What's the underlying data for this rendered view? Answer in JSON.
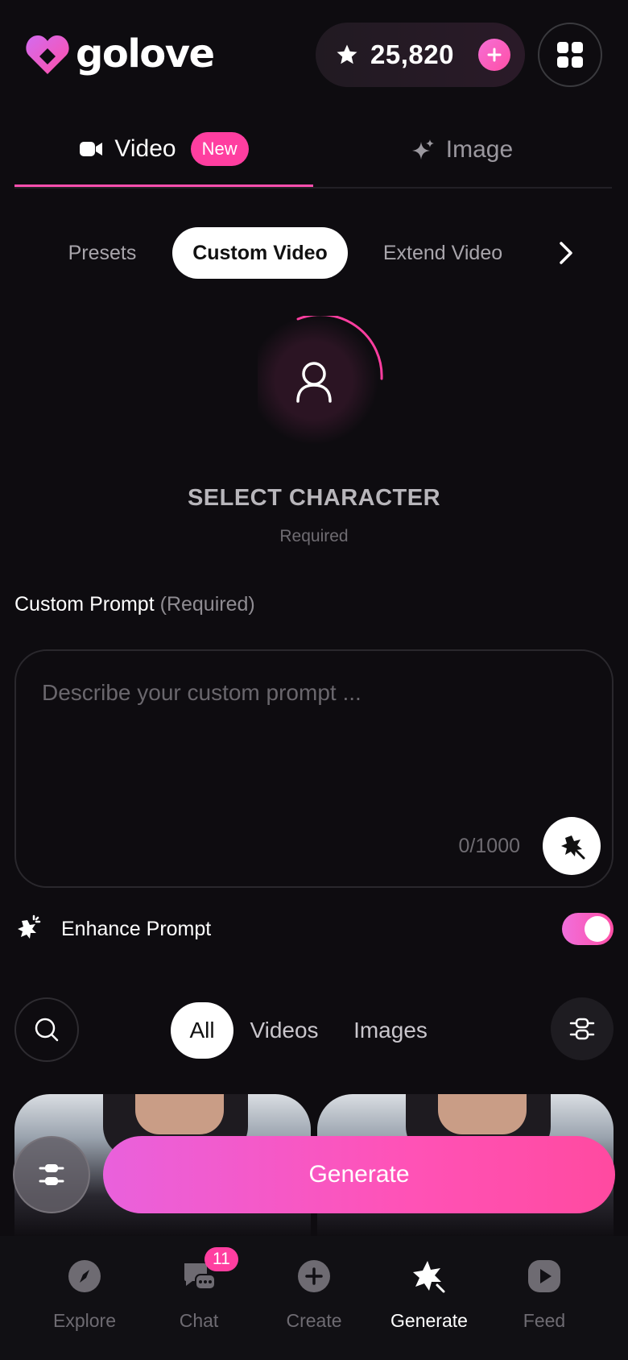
{
  "header": {
    "brand": "golove",
    "credits": "25,820"
  },
  "main_tabs": [
    {
      "label": "Video",
      "badge": "New",
      "active": true
    },
    {
      "label": "Image",
      "active": false
    }
  ],
  "sub_tabs": [
    {
      "label": "Presets"
    },
    {
      "label": "Custom Video",
      "active": true
    },
    {
      "label": "Extend Video"
    }
  ],
  "character": {
    "title": "SELECT CHARACTER",
    "required": "Required"
  },
  "prompt": {
    "label": "Custom Prompt",
    "label_suffix": "(Required)",
    "placeholder": "Describe your custom prompt ...",
    "counter": "0/1000"
  },
  "enhance": {
    "label": "Enhance Prompt",
    "enabled": true
  },
  "filters": [
    {
      "label": "All",
      "active": true
    },
    {
      "label": "Videos"
    },
    {
      "label": "Images"
    }
  ],
  "actions": {
    "generate": "Generate"
  },
  "nav": [
    {
      "label": "Explore",
      "icon": "compass-icon"
    },
    {
      "label": "Chat",
      "icon": "chat-icon",
      "badge": "11"
    },
    {
      "label": "Create",
      "icon": "plus-circle-icon"
    },
    {
      "label": "Generate",
      "icon": "sparkle-icon",
      "active": true
    },
    {
      "label": "Feed",
      "icon": "play-icon"
    }
  ],
  "colors": {
    "accent": "#ff4fae",
    "background": "#0e0c10"
  }
}
